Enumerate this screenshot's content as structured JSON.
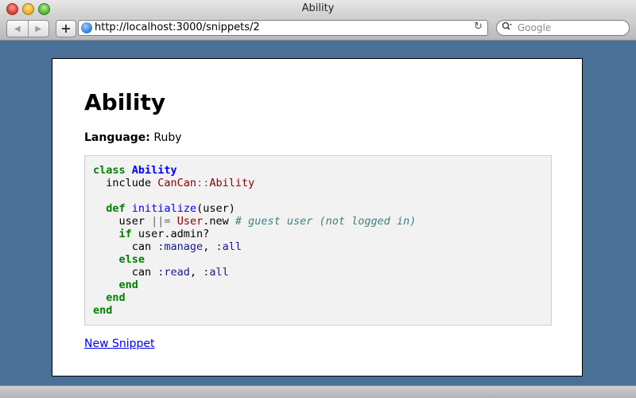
{
  "window": {
    "title": "Ability"
  },
  "toolbar": {
    "url": "http://localhost:3000/snippets/2",
    "search_placeholder": "Google",
    "add_label": "+",
    "back_glyph": "◀",
    "forward_glyph": "▶",
    "reload_glyph": "↻"
  },
  "page": {
    "heading": "Ability",
    "language_label": "Language:",
    "language_value": "Ruby",
    "new_snippet_link": "New Snippet"
  },
  "code": [
    [
      [
        "kw",
        "class"
      ],
      [
        "",
        "",
        " "
      ],
      [
        "cls",
        "Ability"
      ]
    ],
    [
      [
        "",
        "  include "
      ],
      [
        "con",
        "CanCan"
      ],
      [
        "op",
        "::"
      ],
      [
        "con",
        "Ability"
      ]
    ],
    [
      [
        "",
        ""
      ]
    ],
    [
      [
        "",
        "  "
      ],
      [
        "kw",
        "def"
      ],
      [
        "",
        "",
        " "
      ],
      [
        "fn",
        "initialize"
      ],
      [
        "",
        "(user)"
      ]
    ],
    [
      [
        "",
        "    user "
      ],
      [
        "op",
        "||="
      ],
      [
        "",
        "",
        " "
      ],
      [
        "con",
        "User"
      ],
      [
        "",
        ".new "
      ],
      [
        "cm",
        "# guest user (not logged in)"
      ]
    ],
    [
      [
        "",
        "    "
      ],
      [
        "kw",
        "if"
      ],
      [
        "",
        "",
        " user.admin?"
      ]
    ],
    [
      [
        "",
        "      can "
      ],
      [
        "sym",
        ":manage"
      ],
      [
        "",
        ", "
      ],
      [
        "sym",
        ":all"
      ]
    ],
    [
      [
        "",
        "    "
      ],
      [
        "kw",
        "else"
      ]
    ],
    [
      [
        "",
        "      can "
      ],
      [
        "sym",
        ":read"
      ],
      [
        "",
        ", "
      ],
      [
        "sym",
        ":all"
      ]
    ],
    [
      [
        "",
        "    "
      ],
      [
        "kw",
        "end"
      ]
    ],
    [
      [
        "",
        "  "
      ],
      [
        "kw",
        "end"
      ]
    ],
    [
      [
        "kw",
        "end"
      ]
    ]
  ]
}
